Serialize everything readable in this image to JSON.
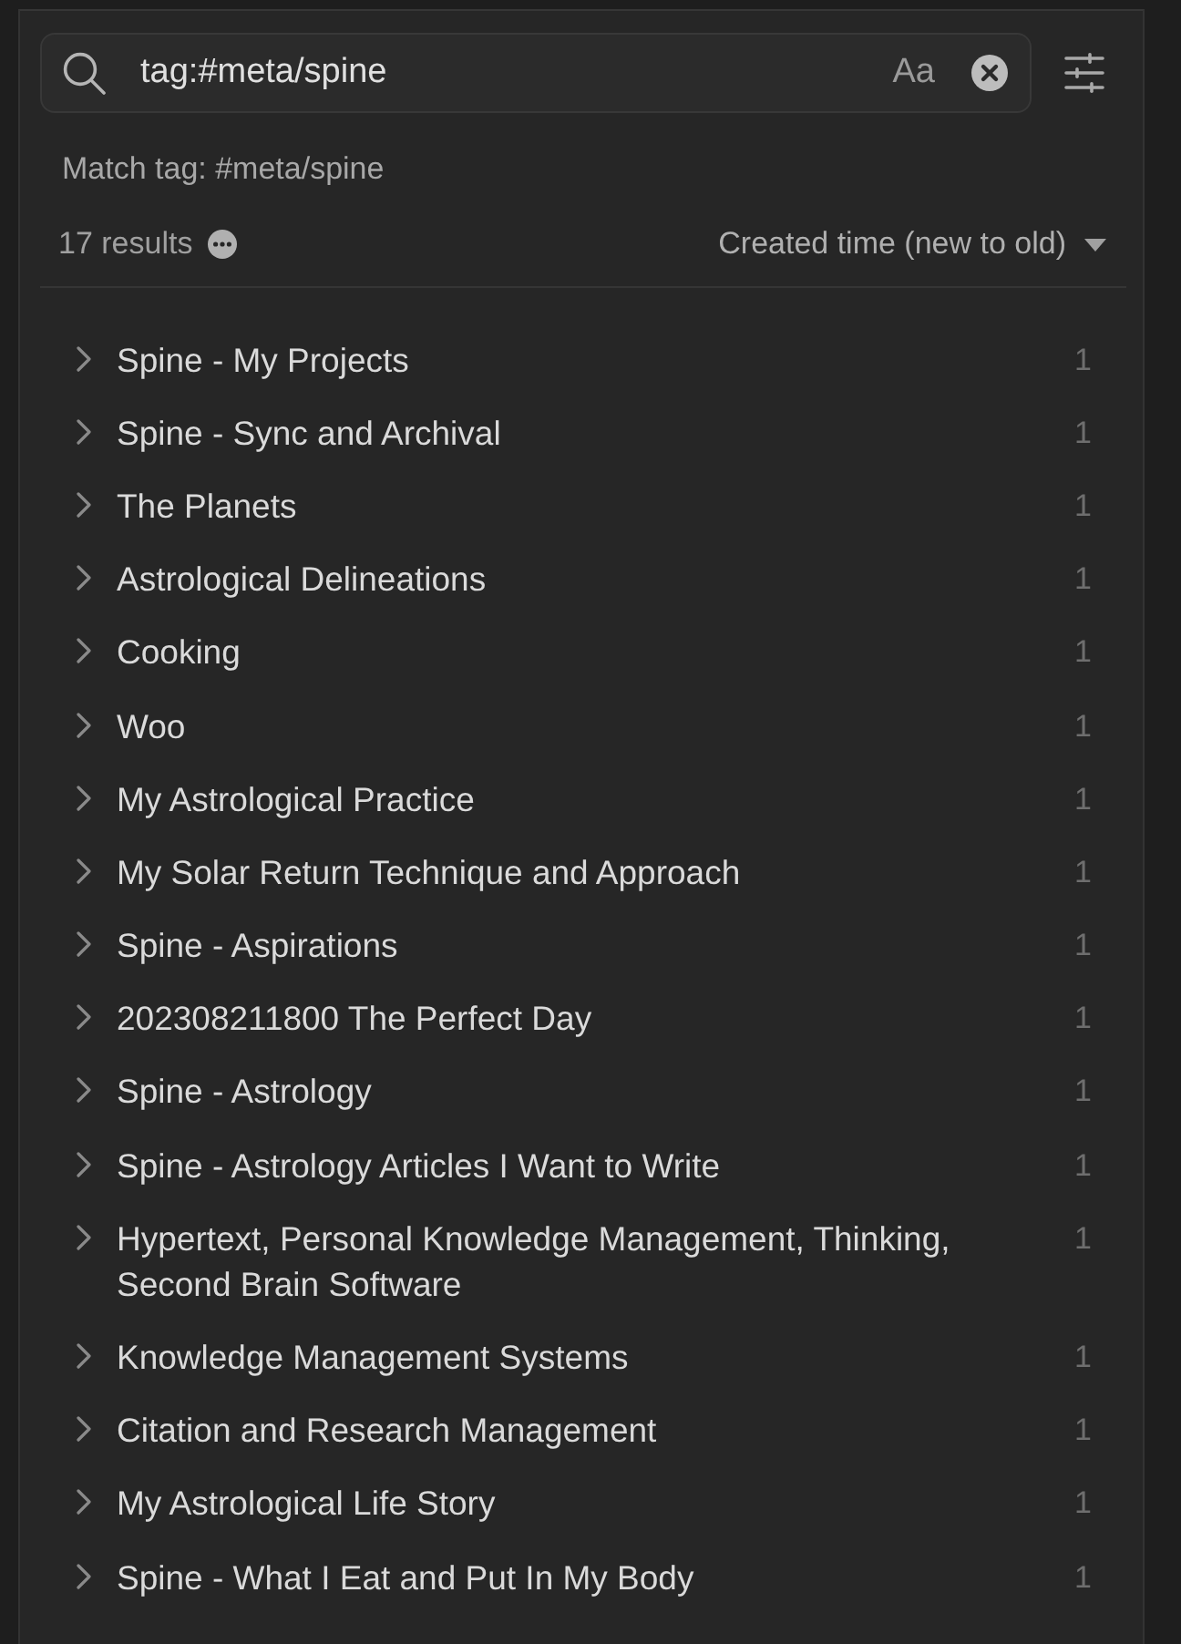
{
  "search": {
    "value": "tag:#meta/spine",
    "match_case": {
      "label": "Aa",
      "on": false
    }
  },
  "match_info": "Match tag: #meta/spine",
  "results_summary": {
    "count": "17 results",
    "sort": "Created time (new to old)"
  },
  "results": [
    {
      "title": "Spine - My Projects",
      "count": "1",
      "expanded": false
    },
    {
      "title": "Spine - Sync and Archival",
      "count": "1",
      "expanded": false
    },
    {
      "title": "The Planets",
      "count": "1",
      "expanded": false
    },
    {
      "title": "Astrological Delineations",
      "count": "1",
      "expanded": false
    },
    {
      "title": "Cooking",
      "count": "1",
      "expanded": false
    },
    {
      "title": "Woo",
      "count": "1",
      "expanded": false
    },
    {
      "title": "My Astrological Practice",
      "count": "1",
      "expanded": false
    },
    {
      "title": "My Solar Return Technique and Approach",
      "count": "1",
      "expanded": false
    },
    {
      "title": "Spine - Aspirations",
      "count": "1",
      "expanded": false
    },
    {
      "title": "202308211800 The Perfect Day",
      "count": "1",
      "expanded": false
    },
    {
      "title": "Spine - Astrology",
      "count": "1",
      "expanded": false
    },
    {
      "title": "Spine - Astrology Articles I Want to Write",
      "count": "1",
      "expanded": false
    },
    {
      "title": "Hypertext, Personal Knowledge Management, Thinking, Second Brain Software",
      "count": "1",
      "expanded": false
    },
    {
      "title": "Knowledge Management Systems",
      "count": "1",
      "expanded": false
    },
    {
      "title": "Citation and Research Management",
      "count": "1",
      "expanded": false
    },
    {
      "title": "My Astrological Life Story",
      "count": "1",
      "expanded": false
    },
    {
      "title": "Spine - What I Eat and Put In My Body",
      "count": "1",
      "expanded": false
    }
  ]
}
